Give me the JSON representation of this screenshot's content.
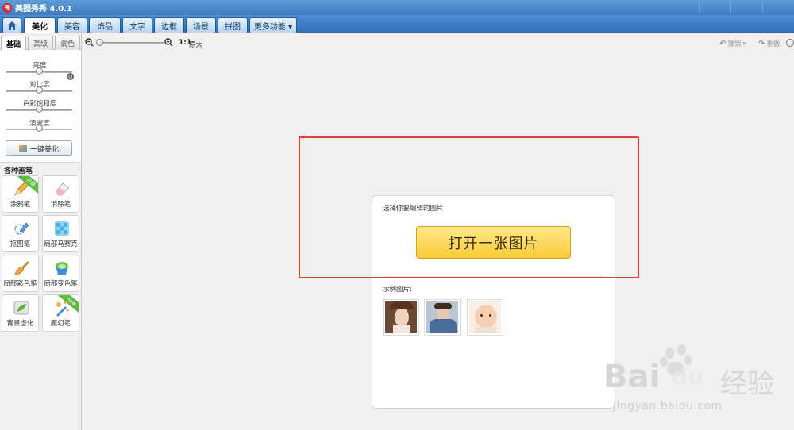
{
  "app": {
    "logo_text": "秀",
    "title": "美图秀秀 4.0.1"
  },
  "nav": {
    "tabs": [
      {
        "label": "美化",
        "active": true
      },
      {
        "label": "美容"
      },
      {
        "label": "饰品"
      },
      {
        "label": "文字"
      },
      {
        "label": "边框"
      },
      {
        "label": "场景"
      },
      {
        "label": "拼图"
      },
      {
        "label": "更多功能 ▾"
      }
    ]
  },
  "panel": {
    "subtabs": [
      "基础",
      "高级",
      "调色"
    ],
    "sliders": [
      {
        "label": "亮度",
        "value": 0.5
      },
      {
        "label": "对比度",
        "value": 0.5
      },
      {
        "label": "色彩饱和度",
        "value": 0.5
      },
      {
        "label": "清晰度",
        "value": 0.5
      }
    ],
    "onekey_label": "一键美化",
    "brush_title": "各种画笔",
    "tools": [
      {
        "label": "涂鸦笔",
        "icon": "pen-icon",
        "badge": "升级"
      },
      {
        "label": "消除笔",
        "icon": "eraser-icon"
      },
      {
        "label": "抠图笔",
        "icon": "cutout-pen-icon"
      },
      {
        "label": "局部马赛克",
        "icon": "mosaic-icon"
      },
      {
        "label": "局部彩色笔",
        "icon": "color-brush-icon"
      },
      {
        "label": "局部变色笔",
        "icon": "recolor-brush-icon"
      },
      {
        "label": "背景虚化",
        "icon": "blur-background-icon"
      },
      {
        "label": "魔幻笔",
        "icon": "magic-pen-icon",
        "badge": "new"
      }
    ]
  },
  "zoom": {
    "ratio_label": "1:1",
    "original_label": "原大",
    "level": 0.0
  },
  "history": {
    "undo_label": "撤销",
    "redo_label": "重做"
  },
  "dialog": {
    "title": "选择你要编辑的图片",
    "open_label": "打开一张图片",
    "sample_label": "示例图片:"
  },
  "watermark": {
    "brand": "Bai",
    "brand_cn": "经验",
    "url": "jingyan.baidu.com"
  },
  "colors": {
    "accent": "#3d7cc4",
    "highlight_box": "#e23c3c",
    "open_button": "#fbcb3a"
  }
}
